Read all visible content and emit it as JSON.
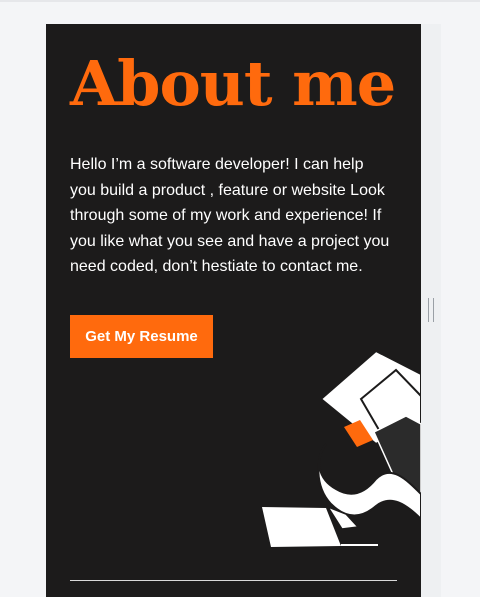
{
  "about": {
    "title": "About me",
    "bio": "Hello I’m a software developer! I can help you build a product , feature or website Look through some of my work and experience! If you like what you see and have a project you need coded, don’t hestiate to contact me.",
    "resume_button_label": "Get My Resume",
    "illustration_icon": "abstract-paper-shapes-illustration"
  },
  "colors": {
    "accent": "#ff6a0d",
    "panel_background": "#1c1b1b",
    "page_background": "#f4f5f7",
    "text": "#ffffff"
  }
}
